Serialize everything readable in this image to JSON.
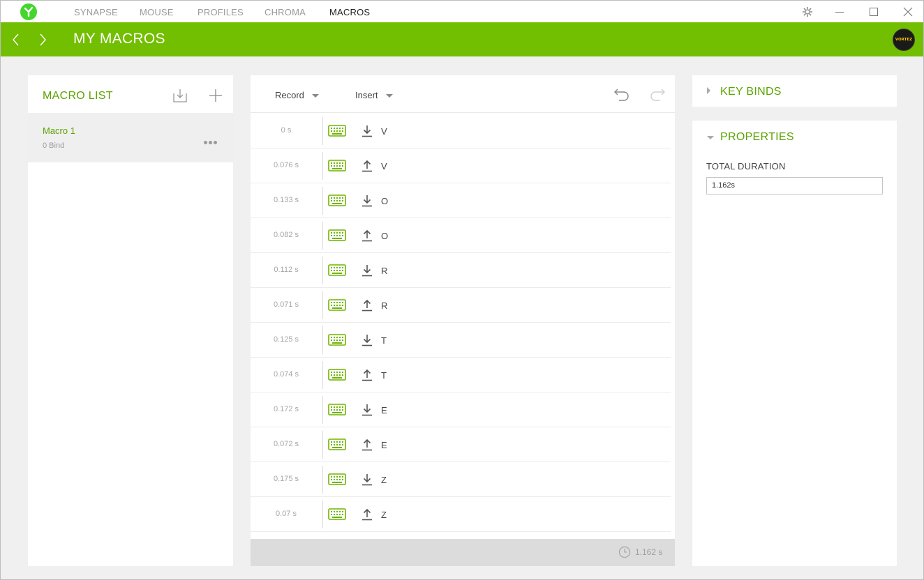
{
  "app": {
    "nav_tabs": [
      {
        "label": "SYNAPSE",
        "active": false
      },
      {
        "label": "MOUSE",
        "active": false
      },
      {
        "label": "PROFILES",
        "active": false
      },
      {
        "label": "CHROMA",
        "active": false
      },
      {
        "label": "MACROS",
        "active": true
      }
    ],
    "window_controls": [
      "settings-gear-icon",
      "minimize-icon",
      "maximize-icon",
      "close-icon"
    ]
  },
  "header": {
    "title": "MY MACROS",
    "avatar_text": "VORTEZ",
    "accent_color": "#72be00"
  },
  "macro_list": {
    "title": "MACRO LIST",
    "items": [
      {
        "name": "Macro 1",
        "binds": "0 Bind"
      }
    ]
  },
  "editor": {
    "record_label": "Record",
    "insert_label": "Insert",
    "steps": [
      {
        "time": "0 s",
        "direction": "down",
        "key": "V"
      },
      {
        "time": "0.076 s",
        "direction": "up",
        "key": "V"
      },
      {
        "time": "0.133 s",
        "direction": "down",
        "key": "O"
      },
      {
        "time": "0.082 s",
        "direction": "up",
        "key": "O"
      },
      {
        "time": "0.112 s",
        "direction": "down",
        "key": "R"
      },
      {
        "time": "0.071 s",
        "direction": "up",
        "key": "R"
      },
      {
        "time": "0.125 s",
        "direction": "down",
        "key": "T"
      },
      {
        "time": "0.074 s",
        "direction": "up",
        "key": "T"
      },
      {
        "time": "0.172 s",
        "direction": "down",
        "key": "E"
      },
      {
        "time": "0.072 s",
        "direction": "up",
        "key": "E"
      },
      {
        "time": "0.175 s",
        "direction": "down",
        "key": "Z"
      },
      {
        "time": "0.07 s",
        "direction": "up",
        "key": "Z"
      }
    ],
    "footer_total": "1.162 s"
  },
  "right": {
    "keybinds_title": "KEY BINDS",
    "properties_title": "PROPERTIES",
    "total_duration_label": "TOTAL DURATION",
    "total_duration_value": "1.162s"
  }
}
